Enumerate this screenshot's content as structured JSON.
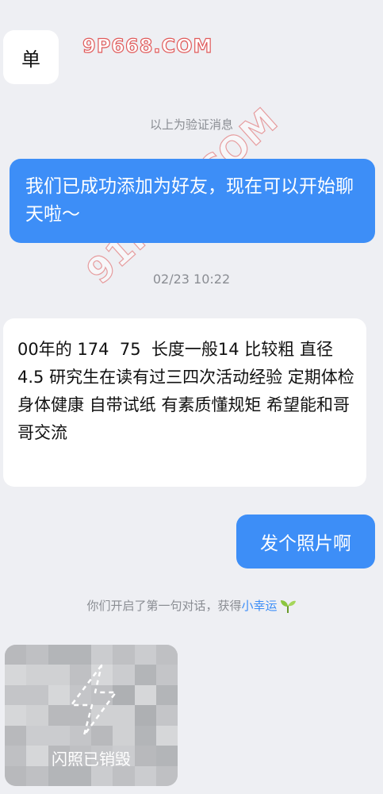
{
  "messages": {
    "first_bubble": "单",
    "verify_notice": "以上为验证消息",
    "friend_added": "我们已成功添加为好友，现在可以开始聊天啦～",
    "timestamp": "02/23 10:22",
    "intro_message": "00年的 174  75  长度一般14 比较粗 直径4.5 研究生在读有过三四次活动经验 定期体检 身体健康 自带试纸 有素质懂规矩 希望能和哥哥交流",
    "reply": "发个照片啊",
    "first_chat_notice_prefix": "你们开启了第一句对话，获得",
    "first_chat_notice_link": "小幸运",
    "flash_photo_label": "闪照已销毁"
  },
  "watermark": {
    "top_text": "9P668.COM",
    "diagonal_text": "91POR.COM"
  },
  "icons": {
    "sprout": "sprout-icon",
    "lightning": "lightning-icon"
  },
  "colors": {
    "background": "#eeeff3",
    "outgoing_bubble": "#3d8ef7",
    "incoming_bubble": "#ffffff",
    "link": "#3d8ef7",
    "watermark_stroke": "#e05a5a"
  }
}
